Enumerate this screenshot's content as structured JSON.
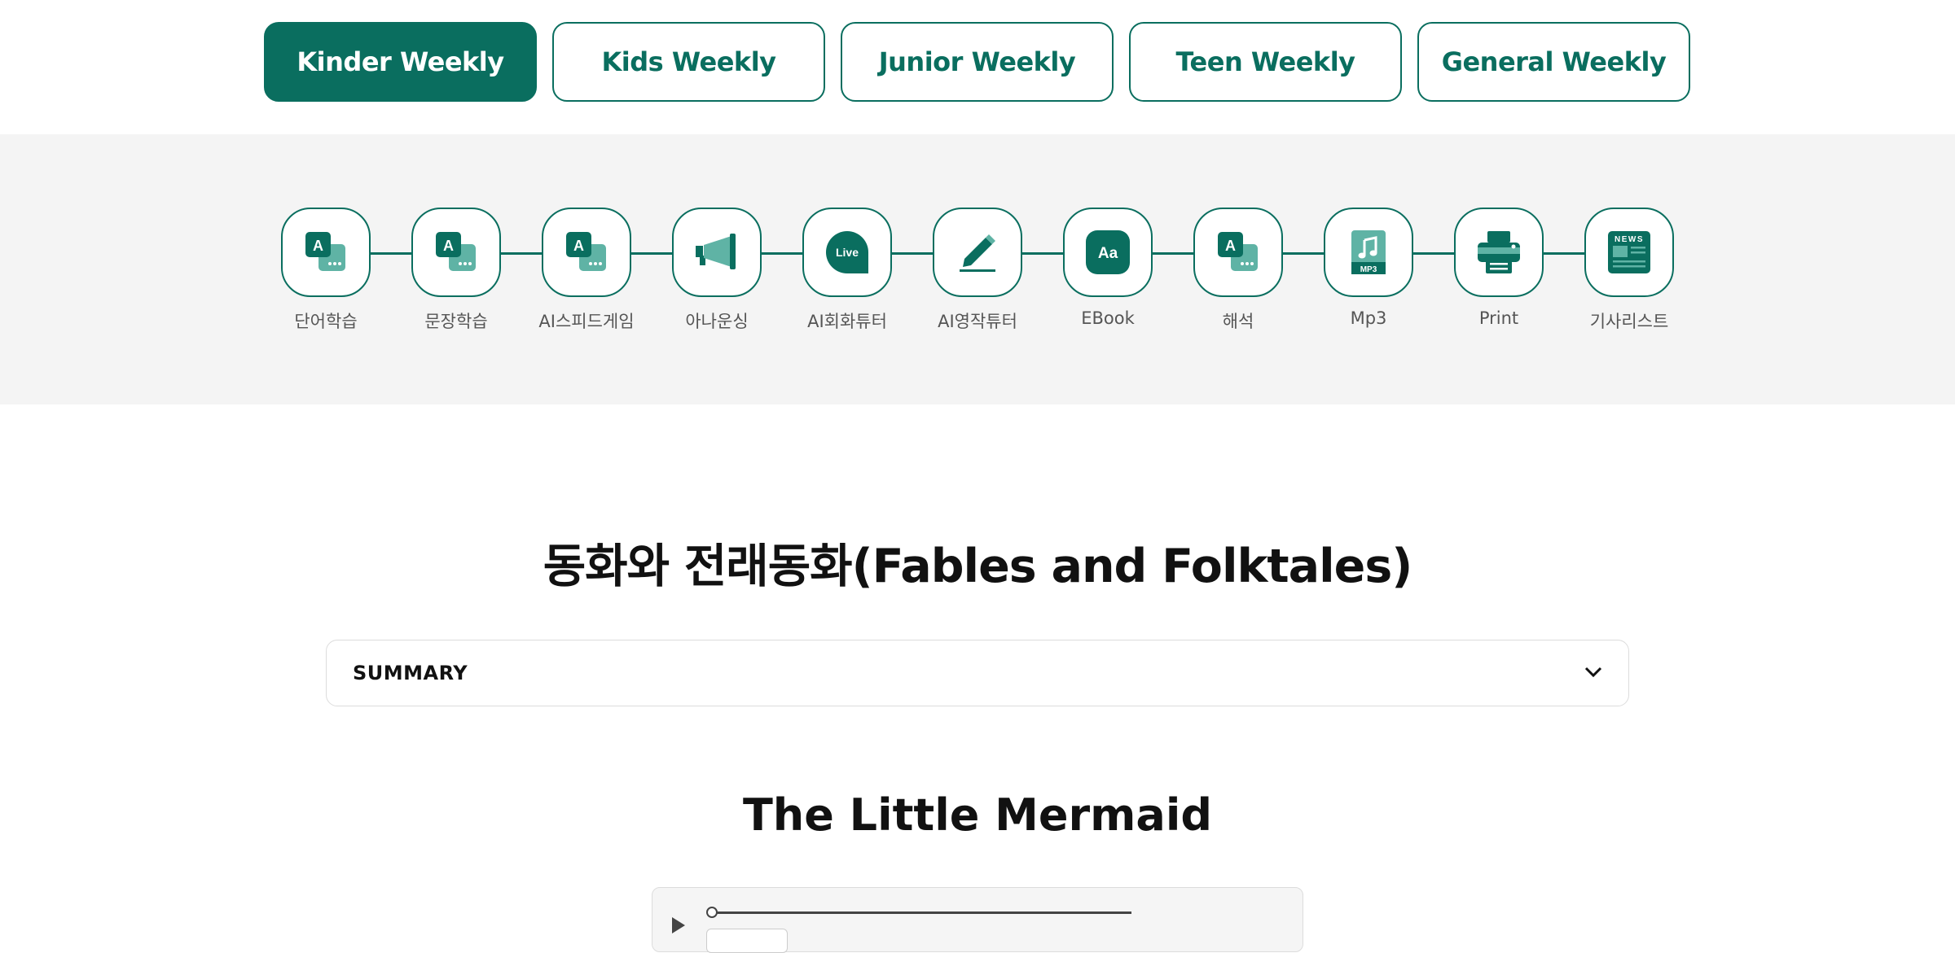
{
  "tabs": [
    {
      "label": "Kinder Weekly",
      "active": true
    },
    {
      "label": "Kids Weekly",
      "active": false
    },
    {
      "label": "Junior Weekly",
      "active": false
    },
    {
      "label": "Teen Weekly",
      "active": false
    },
    {
      "label": "General Weekly",
      "active": false
    }
  ],
  "tools": [
    {
      "label": "단어학습",
      "icon": "word-study-icon"
    },
    {
      "label": "문장학습",
      "icon": "sentence-study-icon"
    },
    {
      "label": "AI스피드게임",
      "icon": "ai-speed-game-icon"
    },
    {
      "label": "아나운싱",
      "icon": "megaphone-icon"
    },
    {
      "label": "AI회화튜터",
      "icon": "live-chat-icon"
    },
    {
      "label": "AI영작튜터",
      "icon": "pencil-icon"
    },
    {
      "label": "EBook",
      "icon": "ebook-icon"
    },
    {
      "label": "해석",
      "icon": "translation-icon"
    },
    {
      "label": "Mp3",
      "icon": "mp3-icon"
    },
    {
      "label": "Print",
      "icon": "printer-icon"
    },
    {
      "label": "기사리스트",
      "icon": "news-list-icon"
    }
  ],
  "icon_text": {
    "live": "Live",
    "aa": "Aa",
    "mp3": "MP3",
    "news": "NEWS",
    "a": "A"
  },
  "section": {
    "title": "동화와 전래동화(Fables and Folktales)"
  },
  "summary": {
    "label": "SUMMARY"
  },
  "story": {
    "title": "The Little Mermaid"
  },
  "audio": {
    "progress": 0
  },
  "colors": {
    "accent": "#0a6e5f",
    "accent_light": "#5fb3a5",
    "band_bg": "#f4f4f4"
  }
}
